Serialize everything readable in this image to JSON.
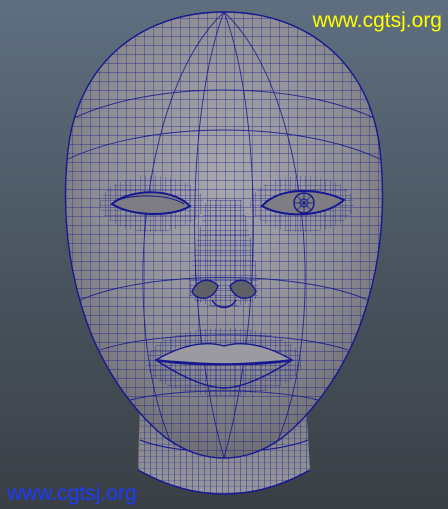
{
  "viewport": {
    "model": "head-wireframe",
    "colors": {
      "background_top": "#5f6f80",
      "background_bottom": "#3a3f45",
      "shading": "#8f8f95",
      "wireframe": "#15188f"
    }
  },
  "watermarks": {
    "top_text": "www.cgtsj.org",
    "top_color": "#ffff00",
    "bottom_text": "www.cgtsj.org",
    "bottom_color": "#1a3cff"
  }
}
